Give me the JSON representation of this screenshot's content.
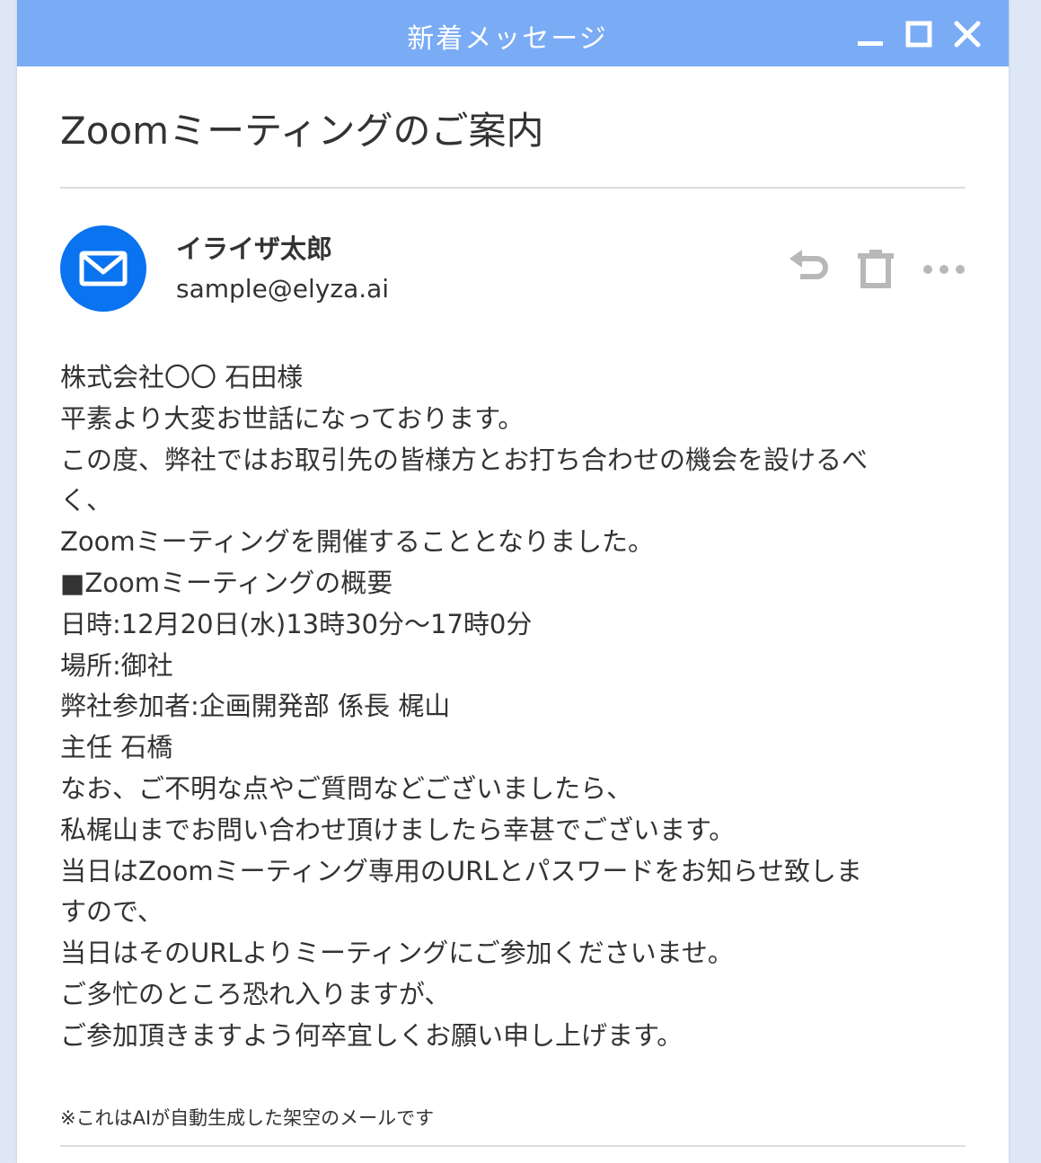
{
  "window": {
    "title": "新着メッセージ",
    "controls": [
      "minimize-icon",
      "maximize-icon",
      "close-icon"
    ],
    "title_bar_color": "#7aabf5"
  },
  "email": {
    "subject": "Zoomミーティングのご案内",
    "sender": {
      "name": "イライザ太郎",
      "email": "sample@elyza.ai",
      "avatar_icon": "mail-envelope-icon",
      "avatar_color": "#0a73f0"
    },
    "actions": [
      "reply-icon",
      "delete-icon",
      "more-icon"
    ],
    "body_lines": [
      "株式会社〇〇 石田様",
      "平素より大変お世話になっております。",
      "この度、弊社ではお取引先の皆様方とお打ち合わせの機会を設けるべ",
      "く、",
      "Zoomミーティングを開催することとなりました。",
      "■Zoomミーティングの概要",
      "日時:12月20日(水)13時30分〜17時0分",
      "場所:御社",
      "弊社参加者:企画開発部 係長 梶山",
      "主任 石橋",
      "なお、ご不明な点やご質問などございましたら、",
      "私梶山までお問い合わせ頂けましたら幸甚でございます。",
      "当日はZoomミーティング専用のURLとパスワードをお知らせ致しま",
      "すので、",
      "当日はそのURLよりミーティングにご参加くださいませ。",
      "ご多忙のところ恐れ入りますが、",
      "ご参加頂きますよう何卒宜しくお願い申し上げます。"
    ],
    "footnote": "※これはAIが自動生成した架空のメールです"
  }
}
